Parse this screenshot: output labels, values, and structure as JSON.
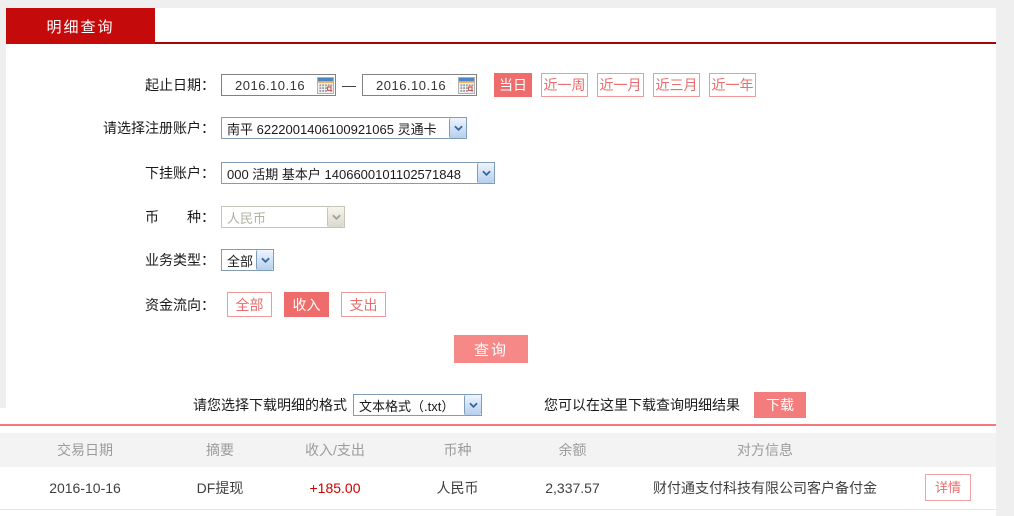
{
  "tab": {
    "label": "明细查询"
  },
  "date_range": {
    "label": "起止日期：",
    "start": "2016.10.16",
    "end": "2016.10.16",
    "separator": "—",
    "quick_buttons": [
      {
        "label": "当日",
        "active": true
      },
      {
        "label": "近一周",
        "active": false
      },
      {
        "label": "近一月",
        "active": false
      },
      {
        "label": "近三月",
        "active": false
      },
      {
        "label": "近一年",
        "active": false
      }
    ]
  },
  "fields": {
    "register_account": {
      "label": "请选择注册账户：",
      "value": "南平 6222001406100921065 灵通卡"
    },
    "sub_account": {
      "label": "下挂账户：",
      "value": "000 活期 基本户 1406600101102571848"
    },
    "currency": {
      "label": "币　　种：",
      "value": "人民币",
      "disabled": true
    },
    "business_type": {
      "label": "业务类型：",
      "value": "全部"
    },
    "fund_direction": {
      "label": "资金流向：",
      "options": [
        {
          "label": "全部",
          "active": false
        },
        {
          "label": "收入",
          "active": true
        },
        {
          "label": "支出",
          "active": false
        }
      ]
    }
  },
  "query_button_label": "查询",
  "download": {
    "format_label": "请您选择下载明细的格式",
    "format_value": "文本格式（.txt）",
    "hint": "您可以在这里下载查询明细结果",
    "button_label": "下载"
  },
  "table": {
    "headers": [
      "交易日期",
      "摘要",
      "收入/支出",
      "币种",
      "余额",
      "对方信息"
    ],
    "rows": [
      {
        "date": "2016-10-16",
        "summary": "DF提现",
        "amount": "+185.00",
        "currency": "人民币",
        "balance": "2,337.57",
        "counterparty": "财付通支付科技有限公司客户备付金",
        "action": "详情"
      }
    ]
  },
  "colors": {
    "tab_red": "#c40a0a",
    "tab_underline": "#a50505",
    "accent_pink": "#ef6c6c",
    "pink_divider": "#f4797c",
    "amount_red": "#cc0000",
    "select_border": "#7f9db9"
  }
}
